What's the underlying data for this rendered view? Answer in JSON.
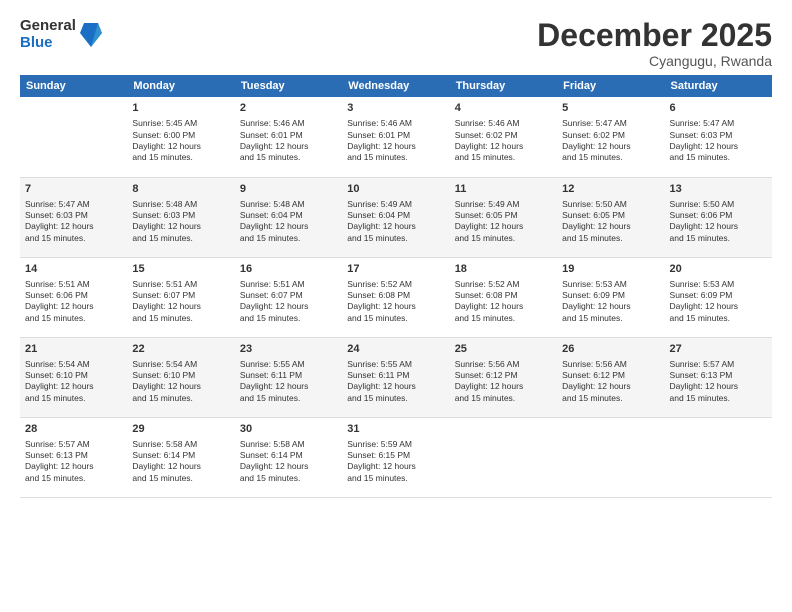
{
  "logo": {
    "general": "General",
    "blue": "Blue"
  },
  "title": "December 2025",
  "subtitle": "Cyangugu, Rwanda",
  "days_header": [
    "Sunday",
    "Monday",
    "Tuesday",
    "Wednesday",
    "Thursday",
    "Friday",
    "Saturday"
  ],
  "weeks": [
    [
      {
        "num": "",
        "info": ""
      },
      {
        "num": "1",
        "info": "Sunrise: 5:45 AM\nSunset: 6:00 PM\nDaylight: 12 hours\nand 15 minutes."
      },
      {
        "num": "2",
        "info": "Sunrise: 5:46 AM\nSunset: 6:01 PM\nDaylight: 12 hours\nand 15 minutes."
      },
      {
        "num": "3",
        "info": "Sunrise: 5:46 AM\nSunset: 6:01 PM\nDaylight: 12 hours\nand 15 minutes."
      },
      {
        "num": "4",
        "info": "Sunrise: 5:46 AM\nSunset: 6:02 PM\nDaylight: 12 hours\nand 15 minutes."
      },
      {
        "num": "5",
        "info": "Sunrise: 5:47 AM\nSunset: 6:02 PM\nDaylight: 12 hours\nand 15 minutes."
      },
      {
        "num": "6",
        "info": "Sunrise: 5:47 AM\nSunset: 6:03 PM\nDaylight: 12 hours\nand 15 minutes."
      }
    ],
    [
      {
        "num": "7",
        "info": "Sunrise: 5:47 AM\nSunset: 6:03 PM\nDaylight: 12 hours\nand 15 minutes."
      },
      {
        "num": "8",
        "info": "Sunrise: 5:48 AM\nSunset: 6:03 PM\nDaylight: 12 hours\nand 15 minutes."
      },
      {
        "num": "9",
        "info": "Sunrise: 5:48 AM\nSunset: 6:04 PM\nDaylight: 12 hours\nand 15 minutes."
      },
      {
        "num": "10",
        "info": "Sunrise: 5:49 AM\nSunset: 6:04 PM\nDaylight: 12 hours\nand 15 minutes."
      },
      {
        "num": "11",
        "info": "Sunrise: 5:49 AM\nSunset: 6:05 PM\nDaylight: 12 hours\nand 15 minutes."
      },
      {
        "num": "12",
        "info": "Sunrise: 5:50 AM\nSunset: 6:05 PM\nDaylight: 12 hours\nand 15 minutes."
      },
      {
        "num": "13",
        "info": "Sunrise: 5:50 AM\nSunset: 6:06 PM\nDaylight: 12 hours\nand 15 minutes."
      }
    ],
    [
      {
        "num": "14",
        "info": "Sunrise: 5:51 AM\nSunset: 6:06 PM\nDaylight: 12 hours\nand 15 minutes."
      },
      {
        "num": "15",
        "info": "Sunrise: 5:51 AM\nSunset: 6:07 PM\nDaylight: 12 hours\nand 15 minutes."
      },
      {
        "num": "16",
        "info": "Sunrise: 5:51 AM\nSunset: 6:07 PM\nDaylight: 12 hours\nand 15 minutes."
      },
      {
        "num": "17",
        "info": "Sunrise: 5:52 AM\nSunset: 6:08 PM\nDaylight: 12 hours\nand 15 minutes."
      },
      {
        "num": "18",
        "info": "Sunrise: 5:52 AM\nSunset: 6:08 PM\nDaylight: 12 hours\nand 15 minutes."
      },
      {
        "num": "19",
        "info": "Sunrise: 5:53 AM\nSunset: 6:09 PM\nDaylight: 12 hours\nand 15 minutes."
      },
      {
        "num": "20",
        "info": "Sunrise: 5:53 AM\nSunset: 6:09 PM\nDaylight: 12 hours\nand 15 minutes."
      }
    ],
    [
      {
        "num": "21",
        "info": "Sunrise: 5:54 AM\nSunset: 6:10 PM\nDaylight: 12 hours\nand 15 minutes."
      },
      {
        "num": "22",
        "info": "Sunrise: 5:54 AM\nSunset: 6:10 PM\nDaylight: 12 hours\nand 15 minutes."
      },
      {
        "num": "23",
        "info": "Sunrise: 5:55 AM\nSunset: 6:11 PM\nDaylight: 12 hours\nand 15 minutes."
      },
      {
        "num": "24",
        "info": "Sunrise: 5:55 AM\nSunset: 6:11 PM\nDaylight: 12 hours\nand 15 minutes."
      },
      {
        "num": "25",
        "info": "Sunrise: 5:56 AM\nSunset: 6:12 PM\nDaylight: 12 hours\nand 15 minutes."
      },
      {
        "num": "26",
        "info": "Sunrise: 5:56 AM\nSunset: 6:12 PM\nDaylight: 12 hours\nand 15 minutes."
      },
      {
        "num": "27",
        "info": "Sunrise: 5:57 AM\nSunset: 6:13 PM\nDaylight: 12 hours\nand 15 minutes."
      }
    ],
    [
      {
        "num": "28",
        "info": "Sunrise: 5:57 AM\nSunset: 6:13 PM\nDaylight: 12 hours\nand 15 minutes."
      },
      {
        "num": "29",
        "info": "Sunrise: 5:58 AM\nSunset: 6:14 PM\nDaylight: 12 hours\nand 15 minutes."
      },
      {
        "num": "30",
        "info": "Sunrise: 5:58 AM\nSunset: 6:14 PM\nDaylight: 12 hours\nand 15 minutes."
      },
      {
        "num": "31",
        "info": "Sunrise: 5:59 AM\nSunset: 6:15 PM\nDaylight: 12 hours\nand 15 minutes."
      },
      {
        "num": "",
        "info": ""
      },
      {
        "num": "",
        "info": ""
      },
      {
        "num": "",
        "info": ""
      }
    ]
  ]
}
